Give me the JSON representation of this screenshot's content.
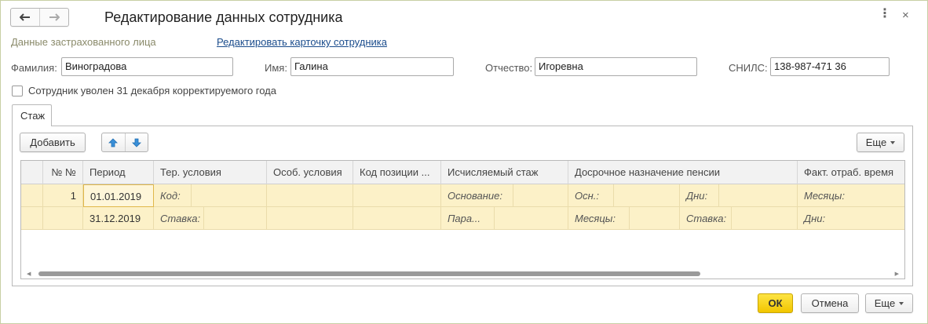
{
  "window": {
    "title": "Редактирование данных сотрудника"
  },
  "header": {
    "insured_person_label": "Данные застрахованного лица",
    "edit_card_link": "Редактировать карточку сотрудника"
  },
  "fields": {
    "surname": {
      "label": "Фамилия:",
      "value": "Виноградова"
    },
    "name": {
      "label": "Имя:",
      "value": "Галина"
    },
    "patronymic": {
      "label": "Отчество:",
      "value": "Игоревна"
    },
    "snils": {
      "label": "СНИЛС:",
      "value": "138-987-471 36"
    }
  },
  "dismissed_checkbox": {
    "label": "Сотрудник уволен 31 декабря корректируемого года",
    "checked": false
  },
  "tabs": [
    {
      "label": "Стаж"
    }
  ],
  "toolbar": {
    "add_label": "Добавить",
    "more_label": "Еще"
  },
  "table": {
    "columns": [
      "№ №",
      "Период",
      "Тер. условия",
      "Особ. условия",
      "Код позиции ...",
      "Исчисляемый стаж",
      "Досрочное назначение пенсии",
      "Факт. отраб. время"
    ],
    "row": {
      "num": "1",
      "period_start": "01.01.2019",
      "period_end": "31.12.2019",
      "ter_code": "Код:",
      "ter_rate": "Ставка:",
      "stazh_basis": "Основание:",
      "stazh_param": "Пара...",
      "early_osn": "Осн.:",
      "early_days": "Дни:",
      "early_months": "Месяцы:",
      "early_rate": "Ставка:",
      "fact_months": "Месяцы:",
      "fact_days": "Дни:"
    }
  },
  "footer": {
    "ok_label": "ОК",
    "cancel_label": "Отмена",
    "more_label": "Еще"
  },
  "colors": {
    "accent_ok": "#f2c600",
    "row_highlight": "#fcf1c8",
    "link": "#1a4c8c"
  }
}
